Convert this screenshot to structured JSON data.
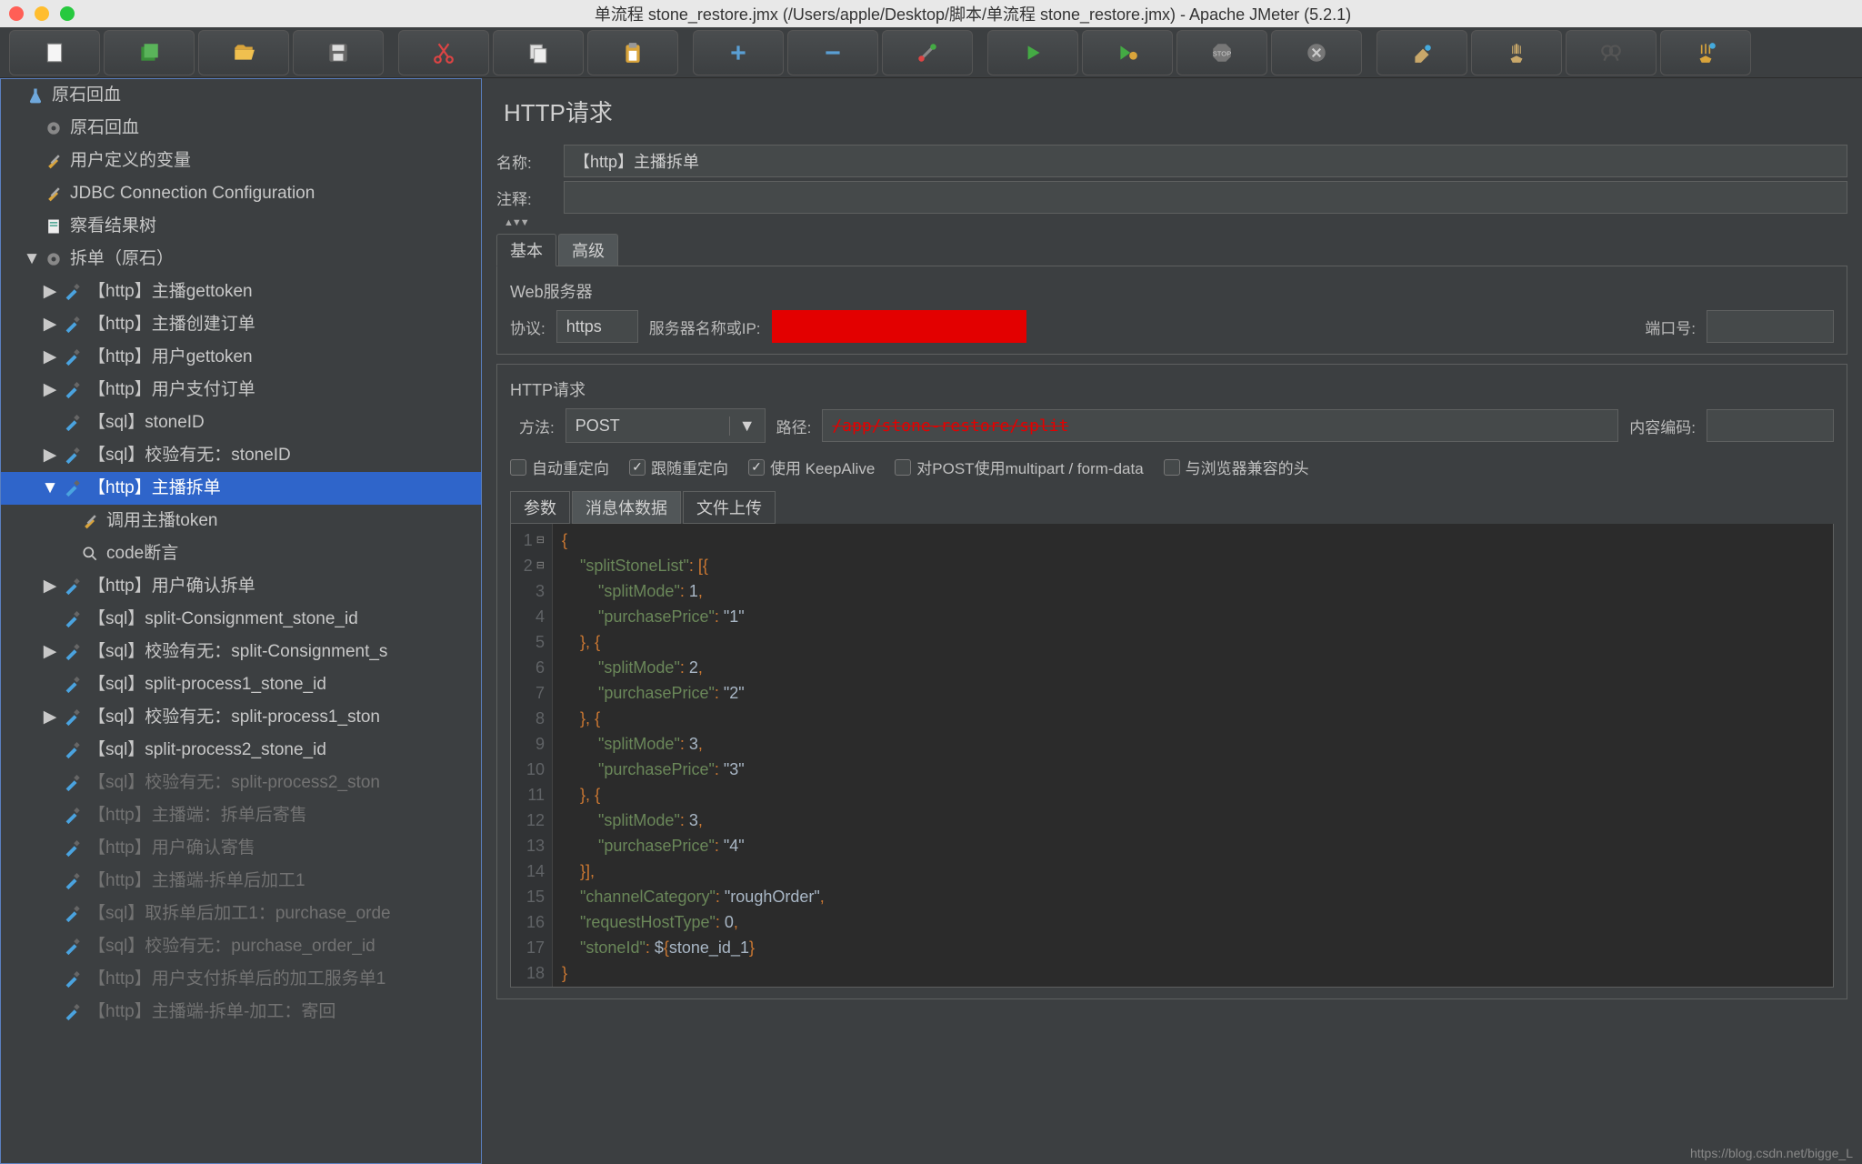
{
  "window": {
    "title": "单流程 stone_restore.jmx (/Users/apple/Desktop/脚本/单流程 stone_restore.jmx) - Apache JMeter (5.2.1)"
  },
  "tree": {
    "items": [
      {
        "lvl": 0,
        "tw": "",
        "icon": "flask",
        "label": "原石回血"
      },
      {
        "lvl": 1,
        "tw": "",
        "icon": "gear",
        "label": "原石回血"
      },
      {
        "lvl": 1,
        "tw": "",
        "icon": "tools",
        "label": "用户定义的变量"
      },
      {
        "lvl": 1,
        "tw": "",
        "icon": "tools",
        "label": "JDBC Connection Configuration"
      },
      {
        "lvl": 1,
        "tw": "",
        "icon": "doc",
        "label": "察看结果树"
      },
      {
        "lvl": 1,
        "tw": "▼",
        "icon": "gear",
        "label": "拆单（原石）"
      },
      {
        "lvl": 2,
        "tw": "▶",
        "icon": "pipette",
        "label": "【http】主播gettoken"
      },
      {
        "lvl": 2,
        "tw": "▶",
        "icon": "pipette",
        "label": "【http】主播创建订单"
      },
      {
        "lvl": 2,
        "tw": "▶",
        "icon": "pipette",
        "label": "【http】用户gettoken"
      },
      {
        "lvl": 2,
        "tw": "▶",
        "icon": "pipette",
        "label": "【http】用户支付订单"
      },
      {
        "lvl": 2,
        "tw": "",
        "icon": "pipette",
        "label": "【sql】stoneID"
      },
      {
        "lvl": 2,
        "tw": "▶",
        "icon": "pipette",
        "label": "【sql】校验有无：stoneID"
      },
      {
        "lvl": 2,
        "tw": "▼",
        "icon": "pipette",
        "label": "【http】主播拆单",
        "sel": true
      },
      {
        "lvl": 3,
        "tw": "",
        "icon": "tools",
        "label": "调用主播token"
      },
      {
        "lvl": 3,
        "tw": "",
        "icon": "magnifier",
        "label": "code断言"
      },
      {
        "lvl": 2,
        "tw": "▶",
        "icon": "pipette",
        "label": "【http】用户确认拆单"
      },
      {
        "lvl": 2,
        "tw": "",
        "icon": "pipette",
        "label": "【sql】split-Consignment_stone_id"
      },
      {
        "lvl": 2,
        "tw": "▶",
        "icon": "pipette",
        "label": "【sql】校验有无：split-Consignment_s"
      },
      {
        "lvl": 2,
        "tw": "",
        "icon": "pipette",
        "label": "【sql】split-process1_stone_id"
      },
      {
        "lvl": 2,
        "tw": "▶",
        "icon": "pipette",
        "label": "【sql】校验有无：split-process1_ston"
      },
      {
        "lvl": 2,
        "tw": "",
        "icon": "pipette",
        "label": "【sql】split-process2_stone_id"
      },
      {
        "lvl": 2,
        "tw": "",
        "icon": "pipette",
        "label": "【sql】校验有无：split-process2_ston",
        "dim": true
      },
      {
        "lvl": 2,
        "tw": "",
        "icon": "pipette",
        "label": "【http】主播端：拆单后寄售",
        "dim": true
      },
      {
        "lvl": 2,
        "tw": "",
        "icon": "pipette",
        "label": "【http】用户确认寄售",
        "dim": true
      },
      {
        "lvl": 2,
        "tw": "",
        "icon": "pipette",
        "label": "【http】主播端-拆单后加工1",
        "dim": true
      },
      {
        "lvl": 2,
        "tw": "",
        "icon": "pipette",
        "label": "【sql】取拆单后加工1：purchase_orde",
        "dim": true
      },
      {
        "lvl": 2,
        "tw": "",
        "icon": "pipette",
        "label": "【sql】校验有无：purchase_order_id",
        "dim": true
      },
      {
        "lvl": 2,
        "tw": "",
        "icon": "pipette",
        "label": "【http】用户支付拆单后的加工服务单1",
        "dim": true
      },
      {
        "lvl": 2,
        "tw": "",
        "icon": "pipette",
        "label": "【http】主播端-拆单-加工：寄回",
        "dim": true
      }
    ]
  },
  "panel": {
    "title": "HTTP请求",
    "name_label": "名称:",
    "name_value": "【http】主播拆单",
    "comment_label": "注释:",
    "comment_value": "",
    "tabs": {
      "basic": "基本",
      "advanced": "高级"
    },
    "webserver": {
      "title": "Web服务器",
      "protocol_label": "协议:",
      "protocol_value": "https",
      "server_label": "服务器名称或IP:",
      "server_value": "████████████████████",
      "port_label": "端口号:",
      "port_value": ""
    },
    "httpreq": {
      "title": "HTTP请求",
      "method_label": "方法:",
      "method_value": "POST",
      "path_label": "路径:",
      "path_value": "/app/stone-restore/split",
      "encoding_label": "内容编码:",
      "encoding_value": ""
    },
    "checks": {
      "auto_redirect": "自动重定向",
      "follow_redirect": "跟随重定向",
      "keepalive": "使用 KeepAlive",
      "multipart": "对POST使用multipart / form-data",
      "browser": "与浏览器兼容的头"
    },
    "body_tabs": {
      "params": "参数",
      "body": "消息体数据",
      "upload": "文件上传"
    },
    "code_lines": [
      "{",
      "    \"splitStoneList\": [{",
      "        \"splitMode\": 1,",
      "        \"purchasePrice\": \"1\"",
      "    }, {",
      "        \"splitMode\": 2,",
      "        \"purchasePrice\": \"2\"",
      "    }, {",
      "        \"splitMode\": 3,",
      "        \"purchasePrice\": \"3\"",
      "    }, {",
      "        \"splitMode\": 3,",
      "        \"purchasePrice\": \"4\"",
      "    }],",
      "    \"channelCategory\": \"roughOrder\",",
      "    \"requestHostType\": 0,",
      "    \"stoneId\": ${stone_id_1}",
      "}"
    ],
    "highlight_line": 17,
    "highlight_text": "${stone_id_1}"
  },
  "watermark": "https://blog.csdn.net/bigge_L"
}
